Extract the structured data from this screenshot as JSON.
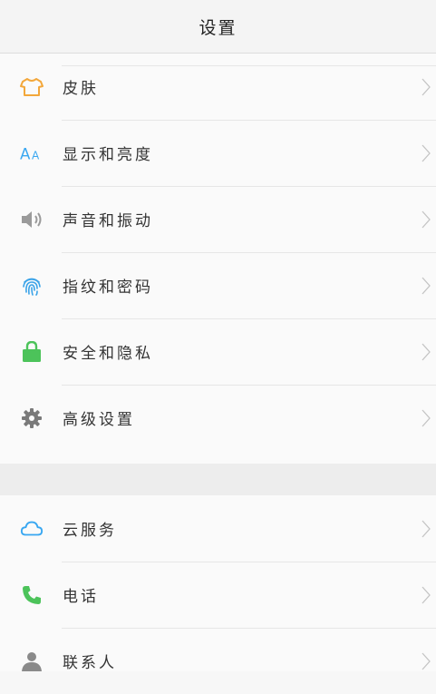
{
  "header": {
    "title": "设置"
  },
  "groups": [
    {
      "items": [
        {
          "label": "皮肤",
          "icon": "tshirt-icon",
          "color": "#f3a73a"
        },
        {
          "label": "显示和亮度",
          "icon": "font-size-icon",
          "color": "#39a7f1"
        },
        {
          "label": "声音和振动",
          "icon": "speaker-icon",
          "color": "#9a9a9a"
        },
        {
          "label": "指纹和密码",
          "icon": "fingerprint-icon",
          "color": "#3aa3e8"
        },
        {
          "label": "安全和隐私",
          "icon": "lock-icon",
          "color": "#4cc35a"
        },
        {
          "label": "高级设置",
          "icon": "gear-icon",
          "color": "#7a7a7a"
        }
      ]
    },
    {
      "items": [
        {
          "label": "云服务",
          "icon": "cloud-icon",
          "color": "#39a7f1"
        },
        {
          "label": "电话",
          "icon": "phone-icon",
          "color": "#4cc35a"
        },
        {
          "label": "联系人",
          "icon": "contact-icon",
          "color": "#8a8a8a"
        }
      ]
    }
  ]
}
